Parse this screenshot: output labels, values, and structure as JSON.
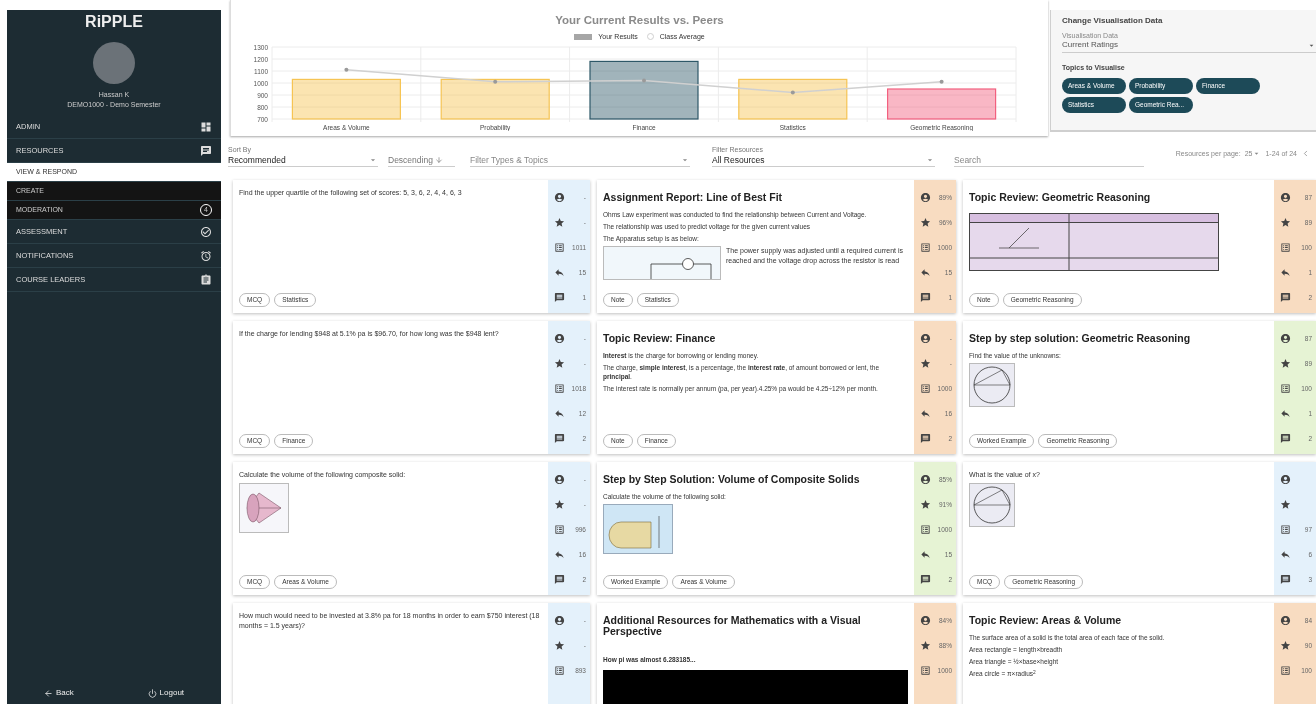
{
  "sidebar": {
    "logo": "RiPPLE",
    "user": {
      "name": "Hassan K",
      "course": "DEMO1000 - Demo Semester"
    },
    "items": [
      {
        "label": "ADMIN",
        "selected": false
      },
      {
        "label": "RESOURCES",
        "selected": false,
        "expanded": true,
        "children": [
          {
            "label": "VIEW & RESPOND",
            "selected": true
          },
          {
            "label": "CREATE",
            "selected": false
          },
          {
            "label": "MODERATION",
            "selected": false,
            "badge": "4"
          }
        ]
      },
      {
        "label": "ASSESSMENT",
        "selected": false
      },
      {
        "label": "NOTIFICATIONS",
        "selected": false
      },
      {
        "label": "COURSE LEADERS",
        "selected": false
      }
    ],
    "footer": [
      {
        "label": "Back"
      },
      {
        "label": "Logout"
      }
    ]
  },
  "chart": {
    "chart_data": {
      "type": "bar",
      "title": "Your Current Results vs. Peers",
      "categories": [
        "Areas & Volume",
        "Probability",
        "Finance",
        "Statistics",
        "Geometric Reasoning"
      ],
      "series": [
        {
          "name": "Your Results",
          "colors": [
            "#f6c453",
            "#f6c453",
            "#2e5868",
            "#f6c453",
            "#f2607f"
          ],
          "values": [
            1030,
            1030,
            1180,
            1030,
            950
          ]
        },
        {
          "name": "Class Average",
          "type": "line",
          "color": "#d0d0d0",
          "values": [
            1110,
            1010,
            1020,
            920,
            1010
          ]
        }
      ],
      "grid": true,
      "ylim": [
        700,
        1300
      ],
      "yticks": [
        700,
        800,
        900,
        1000,
        1100,
        1200,
        1300
      ]
    }
  },
  "visualisation": {
    "title": "Change Visualisation Data",
    "field": {
      "label": "Visualisation Data",
      "value": "Current Ratings"
    },
    "topics_title": "Topics to Visualise",
    "topics": [
      "Areas & Volume",
      "Probability",
      "Finance",
      "Statistics",
      "Geometric Rea..."
    ]
  },
  "filters": {
    "sort": {
      "label": "Sort By",
      "value": "Recommended"
    },
    "order": {
      "value": "Descending"
    },
    "types": {
      "placeholder": "Filter Types & Topics"
    },
    "resources": {
      "label": "Filter Resources",
      "value": "All Resources"
    },
    "search": {
      "placeholder": "Search"
    },
    "pagination": {
      "label": "Resources per page:",
      "per_page": "25",
      "range": "1-24 of 24"
    }
  },
  "cards": [
    {
      "kind": "question",
      "question": "Find the upper quartile of the following set of scores: 5, 3, 6, 2, 4, 4, 6, 3",
      "tags": [
        "MCQ",
        "Statistics"
      ],
      "color": "#e4f1fb",
      "stats": [
        {
          "value": "-"
        },
        {
          "value": "-"
        },
        {
          "value": "1011"
        },
        {
          "value": "15"
        },
        {
          "value": "1"
        }
      ]
    },
    {
      "kind": "resource",
      "title": "Assignment Report: Line of Best Fit",
      "paragraphs": [
        {
          "text": "Ohms Law experiment was conducted to find the relationship between Current and Voltage.",
          "bold": false
        },
        {
          "text": "The relationship was used to predict voltage for the given current values",
          "bold": false
        },
        {
          "text": "The Apparatus setup is as below:",
          "bold": false
        }
      ],
      "figure": {
        "kind": "circuit",
        "caption": "The power supply was adjusted until a required current is reached and the voltage drop across the resistor is read"
      },
      "tags": [
        "Note",
        "Statistics"
      ],
      "color": "#f8dcc1",
      "stats": [
        {
          "value": "89%"
        },
        {
          "value": "96%"
        },
        {
          "value": "1000"
        },
        {
          "value": "15"
        },
        {
          "value": "1"
        }
      ]
    },
    {
      "kind": "resource",
      "title": "Topic Review: Geometric Reasoning",
      "figure": {
        "kind": "table"
      },
      "tags": [
        "Note",
        "Geometric Reasoning"
      ],
      "color": "#f8dcc1",
      "stats": [
        {
          "value": "87"
        },
        {
          "value": "89"
        },
        {
          "value": "100"
        },
        {
          "value": "1"
        },
        {
          "value": "2"
        }
      ]
    },
    {
      "kind": "question",
      "question": "If the charge for lending $948 at 5.1% pa is $96.70, for how long was the $948 lent?",
      "tags": [
        "MCQ",
        "Finance"
      ],
      "color": "#e4f1fb",
      "stats": [
        {
          "value": "-"
        },
        {
          "value": "-"
        },
        {
          "value": "1018"
        },
        {
          "value": "12"
        },
        {
          "value": "2"
        }
      ]
    },
    {
      "kind": "resource",
      "title": "Topic Review: Finance",
      "paragraphs": [
        {
          "text": "**Interest** is the charge for borrowing or lending money.",
          "bold": false
        },
        {
          "text": "The charge, **simple interest**, is a percentage, the **interest rate**, of amount borrowed or lent, the **principal**.",
          "bold": false
        },
        {
          "text": "The interest rate is normally per annum (pa, per year).4.25% pa would be 4.25÷12% per month.",
          "bold": false
        }
      ],
      "tags": [
        "Note",
        "Finance"
      ],
      "color": "#f8dcc1",
      "stats": [
        {
          "value": "-"
        },
        {
          "value": "-"
        },
        {
          "value": "1000"
        },
        {
          "value": "16"
        },
        {
          "value": "2"
        }
      ]
    },
    {
      "kind": "resource",
      "title": "Step by step solution: Geometric Reasoning",
      "paragraphs": [
        {
          "text": "Find the value of the unknowns:",
          "bold": false
        }
      ],
      "figure": {
        "kind": "circle"
      },
      "tags": [
        "Worked Example",
        "Geometric Reasoning"
      ],
      "color": "#e6f3d4",
      "stats": [
        {
          "value": "87"
        },
        {
          "value": "89"
        },
        {
          "value": "100"
        },
        {
          "value": "1"
        },
        {
          "value": "2"
        }
      ]
    },
    {
      "kind": "question",
      "question": "Calculate the volume of the following composite solid:",
      "figure": {
        "kind": "cone"
      },
      "tags": [
        "MCQ",
        "Areas & Volume"
      ],
      "color": "#e4f1fb",
      "stats": [
        {
          "value": "-"
        },
        {
          "value": "-"
        },
        {
          "value": "996"
        },
        {
          "value": "16"
        },
        {
          "value": "2"
        }
      ]
    },
    {
      "kind": "resource",
      "title": "Step by Step Solution: Volume of Composite Solids",
      "paragraphs": [
        {
          "text": "Calculate the volume of the following solid:",
          "bold": false
        }
      ],
      "figure": {
        "kind": "solid"
      },
      "tags": [
        "Worked Example",
        "Areas & Volume"
      ],
      "color": "#e6f3d4",
      "stats": [
        {
          "value": "85%"
        },
        {
          "value": "91%"
        },
        {
          "value": "1000"
        },
        {
          "value": "15"
        },
        {
          "value": "2"
        }
      ]
    },
    {
      "kind": "question",
      "question": "What is the value of x?",
      "figure": {
        "kind": "circle"
      },
      "tags": [
        "MCQ",
        "Geometric Reasoning"
      ],
      "color": "#e4f1fb",
      "stats": [
        {
          "kind": "user"
        },
        {
          "kind": "star"
        },
        {
          "value": "97"
        },
        {
          "value": "6"
        },
        {
          "value": "3"
        }
      ]
    },
    {
      "kind": "question",
      "question": "How much would need to be invested at 3.8% pa for 18 months in order to earn $750 interest (18 months = 1.5 years)?",
      "color": "#e4f1fb",
      "stats": [
        {
          "value": "-"
        },
        {
          "value": "-"
        },
        {
          "value": "893"
        }
      ]
    },
    {
      "kind": "resource",
      "title": "Additional Resources for Mathematics with a Visual Perspective",
      "paragraphs": [
        {
          "text": "How pi was almost 6.283185...",
          "bold": true
        }
      ],
      "figure": {
        "kind": "video"
      },
      "color": "#f8dcc1",
      "stats": [
        {
          "value": "84%"
        },
        {
          "value": "88%"
        },
        {
          "value": "1000"
        }
      ]
    },
    {
      "kind": "resource",
      "title": "Topic Review: Areas & Volume",
      "paragraphs": [
        {
          "text": "The surface area of a solid is the total area of each face of the solid.",
          "bold": false
        },
        {
          "text": "Area rectangle = length×breadth",
          "bold": false
        },
        {
          "text": "Area triangle = ½×base×height",
          "bold": false
        },
        {
          "text": "Area circle = π×radius$^{2}$",
          "bold": false
        }
      ],
      "color": "#f8dcc1",
      "stats": [
        {
          "value": "84"
        },
        {
          "value": "90"
        },
        {
          "value": "100"
        }
      ]
    }
  ]
}
